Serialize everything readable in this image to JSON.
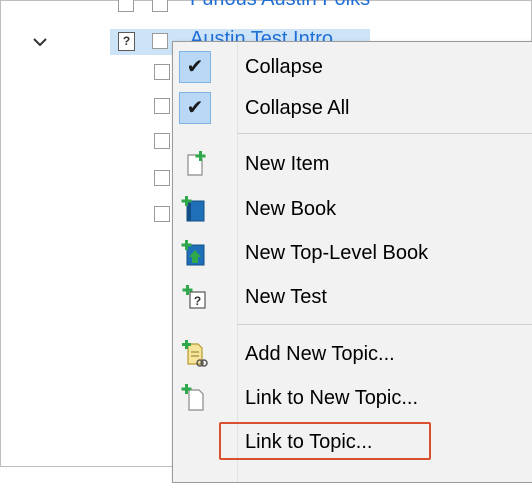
{
  "tree": {
    "item_above": "Furious Austin Folks",
    "selected_item": "Austin Test Intro",
    "test_badge": "?"
  },
  "menu": {
    "items": [
      {
        "label": "Collapse",
        "checked": true,
        "icon": "checkmark-icon"
      },
      {
        "label": "Collapse All",
        "checked": true,
        "icon": "checkmark-icon"
      },
      {
        "label": "New Item",
        "icon": "new-item-icon"
      },
      {
        "label": "New Book",
        "icon": "new-book-icon"
      },
      {
        "label": "New Top-Level Book",
        "icon": "new-top-level-book-icon"
      },
      {
        "label": "New Test",
        "icon": "new-test-icon"
      },
      {
        "label": "Add New Topic...",
        "icon": "add-new-topic-icon"
      },
      {
        "label": "Link to New Topic...",
        "icon": "link-to-new-topic-icon"
      },
      {
        "label": "Link to Topic...",
        "icon": "link-to-topic-icon",
        "highlighted": true
      }
    ],
    "check_glyph": "✔",
    "test_glyph": "?"
  },
  "colors": {
    "highlight_border": "#d9502f",
    "selection": "#cde3f7",
    "link_text": "#1f6fd6",
    "book_blue": "#1e6fb8",
    "plus_green": "#2ea84a"
  }
}
